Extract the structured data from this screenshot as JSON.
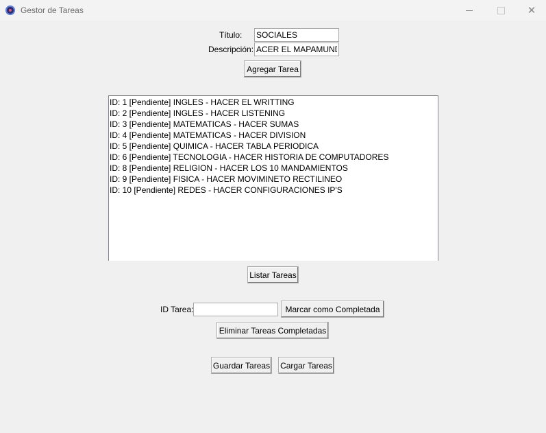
{
  "window": {
    "title": "Gestor de Tareas"
  },
  "form": {
    "titulo_label": "Título:",
    "titulo_value": "SOCIALES",
    "descripcion_label": "Descripción:",
    "descripcion_value": "ACER EL MAPAMUNDI",
    "add_button": "Agregar Tarea"
  },
  "tasks": [
    "ID: 1 [Pendiente] INGLES - HACER EL WRITTING",
    "ID: 2 [Pendiente] INGLES - HACER LISTENING",
    "ID: 3 [Pendiente] MATEMATICAS - HACER SUMAS",
    "ID: 4 [Pendiente] MATEMATICAS - HACER DIVISION",
    "ID: 5 [Pendiente] QUIMICA - HACER TABLA PERIODICA",
    "ID: 6 [Pendiente] TECNOLOGIA - HACER HISTORIA DE COMPUTADORES",
    "ID: 8 [Pendiente] RELIGION - HACER LOS 10 MANDAMIENTOS",
    "ID: 9 [Pendiente] FISICA - HACER MOVIMINETO RECTILINEO",
    "ID: 10 [Pendiente] REDES - HACER CONFIGURACIONES IP'S"
  ],
  "list_button": "Listar Tareas",
  "complete": {
    "id_label": "ID Tarea:",
    "id_value": "",
    "mark_button": "Marcar como Completada"
  },
  "delete_button": "Eliminar Tareas Completadas",
  "save_button": "Guardar Tareas",
  "load_button": "Cargar Tareas",
  "icons": {
    "app": "app-icon",
    "minimize": "minimize-icon",
    "maximize": "maximize-icon",
    "close": "close-icon"
  }
}
